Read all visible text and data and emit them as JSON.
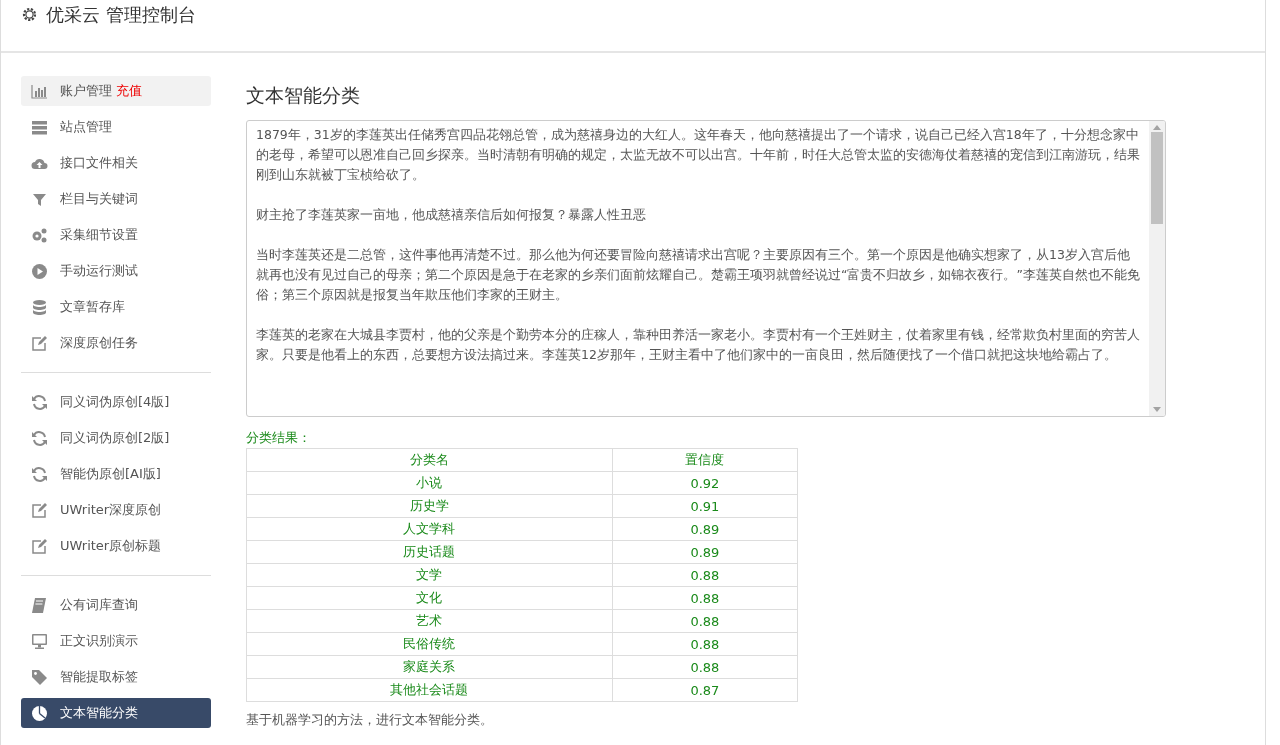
{
  "header": {
    "title": "优采云 管理控制台"
  },
  "sidebar": {
    "groups": [
      {
        "items": [
          {
            "label": "账户管理",
            "badge": "充值",
            "kind": "chart",
            "selected": false
          },
          {
            "label": "站点管理",
            "kind": "server",
            "selected": false
          },
          {
            "label": "接口文件相关",
            "kind": "cloud",
            "selected": false
          },
          {
            "label": "栏目与关键词",
            "kind": "filter",
            "selected": false
          },
          {
            "label": "采集细节设置",
            "kind": "gears",
            "selected": false
          },
          {
            "label": "手动运行测试",
            "kind": "play",
            "selected": false
          },
          {
            "label": "文章暂存库",
            "kind": "database",
            "selected": false
          },
          {
            "label": "深度原创任务",
            "kind": "edit",
            "selected": false
          }
        ]
      },
      {
        "items": [
          {
            "label": "同义词伪原创[4版]",
            "kind": "refresh",
            "selected": false
          },
          {
            "label": "同义词伪原创[2版]",
            "kind": "refresh",
            "selected": false
          },
          {
            "label": "智能伪原创[AI版]",
            "kind": "refresh",
            "selected": false
          },
          {
            "label": "UWriter深度原创",
            "kind": "edit",
            "selected": false
          },
          {
            "label": "UWriter原创标题",
            "kind": "edit",
            "selected": false
          }
        ]
      },
      {
        "items": [
          {
            "label": "公有词库查询",
            "kind": "book",
            "selected": false
          },
          {
            "label": "正文识别演示",
            "kind": "monitor",
            "selected": false
          },
          {
            "label": "智能提取标签",
            "kind": "tag",
            "selected": false
          },
          {
            "label": "文本智能分类",
            "kind": "pie",
            "selected": true
          }
        ]
      }
    ]
  },
  "main": {
    "title": "文本智能分类",
    "text_input": {
      "paragraphs": [
        "1879年，31岁的李莲英出任储秀宫四品花翎总管，成为慈禧身边的大红人。这年春天，他向慈禧提出了一个请求，说自己已经入宫18年了，十分想念家中的老母，希望可以恩准自己回乡探亲。当时清朝有明确的规定，太监无故不可以出宫。十年前，时任大总管太监的安德海仗着慈禧的宠信到江南游玩，结果刚到山东就被丁宝桢给砍了。",
        "财主抢了李莲英家一亩地，他成慈禧亲信后如何报复？暴露人性丑恶",
        "当时李莲英还是二总管，这件事他再清楚不过。那么他为何还要冒险向慈禧请求出宫呢？主要原因有三个。第一个原因是他确实想家了，从13岁入宫后他就再也没有见过自己的母亲；第二个原因是急于在老家的乡亲们面前炫耀自己。楚霸王项羽就曾经说过“富贵不归故乡，如锦衣夜行。”李莲英自然也不能免俗；第三个原因就是报复当年欺压他们李家的王财主。",
        "李莲英的老家在大城县李贾村，他的父亲是个勤劳本分的庄稼人，靠种田养活一家老小。李贾村有一个王姓财主，仗着家里有钱，经常欺负村里面的穷苦人家。只要是他看上的东西，总要想方设法搞过来。李莲英12岁那年，王财主看中了他们家中的一亩良田，然后随便找了一个借口就把这块地给霸占了。"
      ]
    },
    "result_label": "分类结果：",
    "table": {
      "columns": [
        "分类名",
        "置信度"
      ],
      "rows": [
        [
          "小说",
          "0.92"
        ],
        [
          "历史学",
          "0.91"
        ],
        [
          "人文学科",
          "0.89"
        ],
        [
          "历史话题",
          "0.89"
        ],
        [
          "文学",
          "0.88"
        ],
        [
          "文化",
          "0.88"
        ],
        [
          "艺术",
          "0.88"
        ],
        [
          "民俗传统",
          "0.88"
        ],
        [
          "家庭关系",
          "0.88"
        ],
        [
          "其他社会话题",
          "0.87"
        ]
      ]
    },
    "footnote": "基于机器学习的方法，进行文本智能分类。"
  }
}
